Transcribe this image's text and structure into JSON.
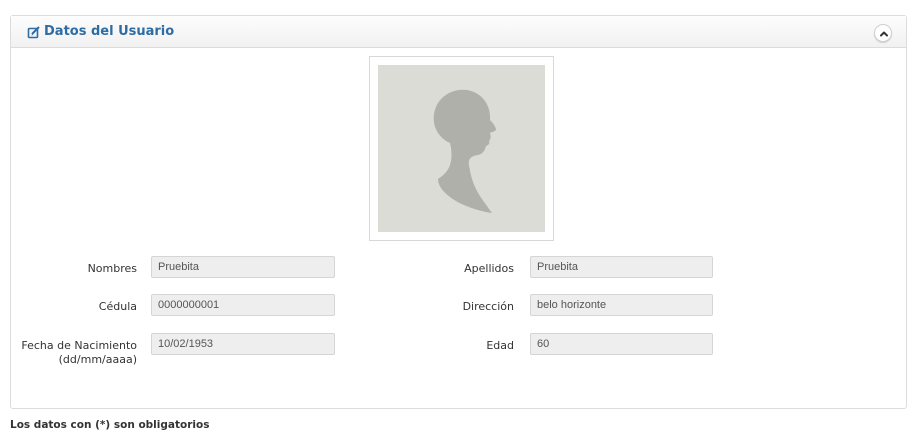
{
  "panel": {
    "title": "Datos del Usuario",
    "header_icon": "edit-icon",
    "collapse_icon": "chevron-up-icon"
  },
  "photo": {
    "icon": "avatar-silhouette-icon"
  },
  "form": {
    "nombres": {
      "label": "Nombres",
      "value": "Pruebita"
    },
    "apellidos": {
      "label": "Apellidos",
      "value": "Pruebita"
    },
    "cedula": {
      "label": "Cédula",
      "value": "0000000001"
    },
    "direccion": {
      "label": "Dirección",
      "value": "belo horizonte"
    },
    "fecha": {
      "label": "Fecha de Nacimiento",
      "sublabel": "(dd/mm/aaaa)",
      "value": "10/02/1953"
    },
    "edad": {
      "label": "Edad",
      "value": "60"
    }
  },
  "footer": {
    "note": "Los datos con (*) son obligatorios"
  },
  "colors": {
    "title": "#2e6da4",
    "field_bg": "#eeeeee",
    "photo_bg": "#dcdcd6"
  }
}
